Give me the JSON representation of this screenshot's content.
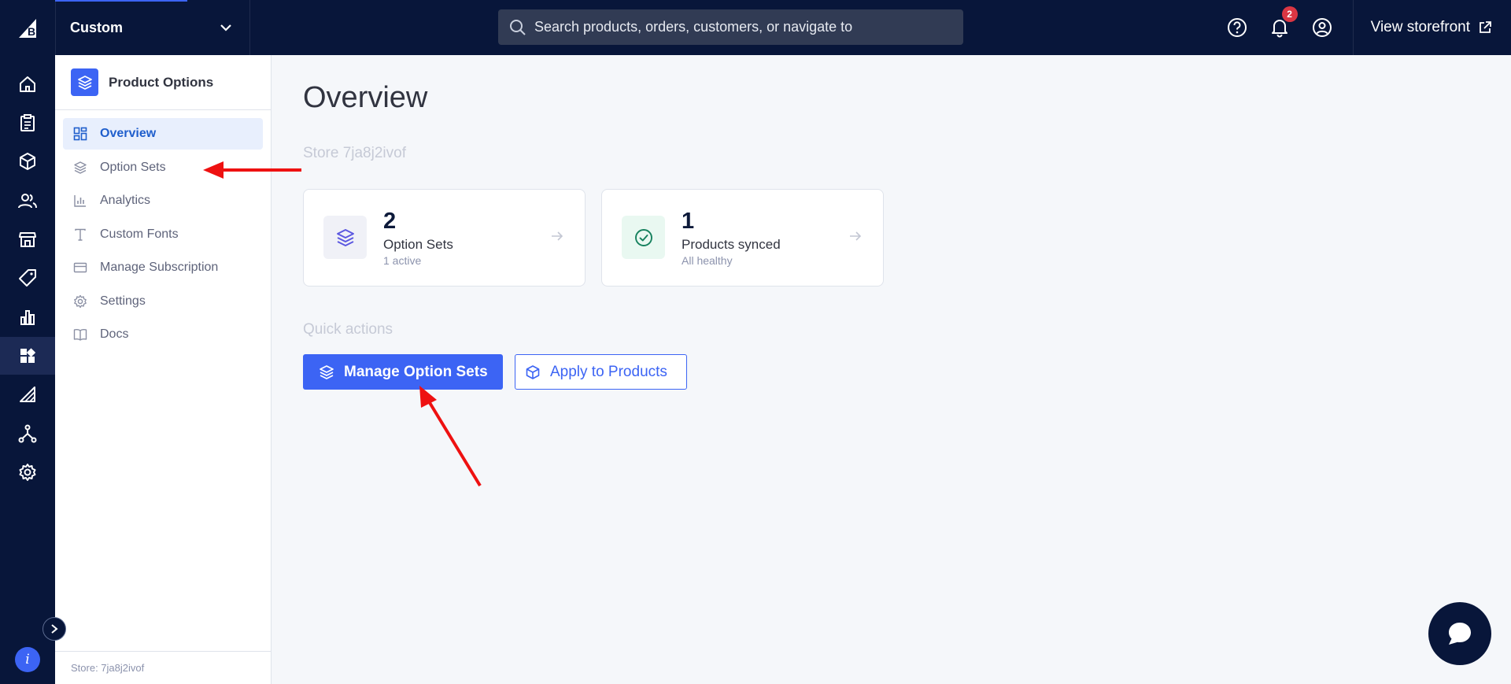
{
  "header": {
    "store_name": "Custom",
    "search_placeholder": "Search products, orders, customers, or navigate to",
    "notification_count": "2",
    "view_storefront": "View storefront"
  },
  "app": {
    "title": "Product Options",
    "nav": [
      {
        "label": "Overview",
        "icon": "overview-grid-icon",
        "active": true
      },
      {
        "label": "Option Sets",
        "icon": "layers-icon"
      },
      {
        "label": "Analytics",
        "icon": "bar-chart-icon"
      },
      {
        "label": "Custom Fonts",
        "icon": "text-t-icon"
      },
      {
        "label": "Manage Subscription",
        "icon": "credit-card-icon"
      },
      {
        "label": "Settings",
        "icon": "gear-icon"
      },
      {
        "label": "Docs",
        "icon": "book-icon"
      }
    ],
    "footer": "Store: 7ja8j2ivof"
  },
  "main": {
    "title": "Overview",
    "store_label": "Store 7ja8j2ivof",
    "cards": [
      {
        "number": "2",
        "label": "Option Sets",
        "sub": "1 active"
      },
      {
        "number": "1",
        "label": "Products synced",
        "sub": "All healthy"
      }
    ],
    "quick_actions_label": "Quick actions",
    "primary_button": "Manage Option Sets",
    "secondary_button": "Apply to Products"
  },
  "colors": {
    "topbar": "#08163a",
    "accent": "#3c64f4",
    "annotation_arrow": "#ee1111"
  }
}
